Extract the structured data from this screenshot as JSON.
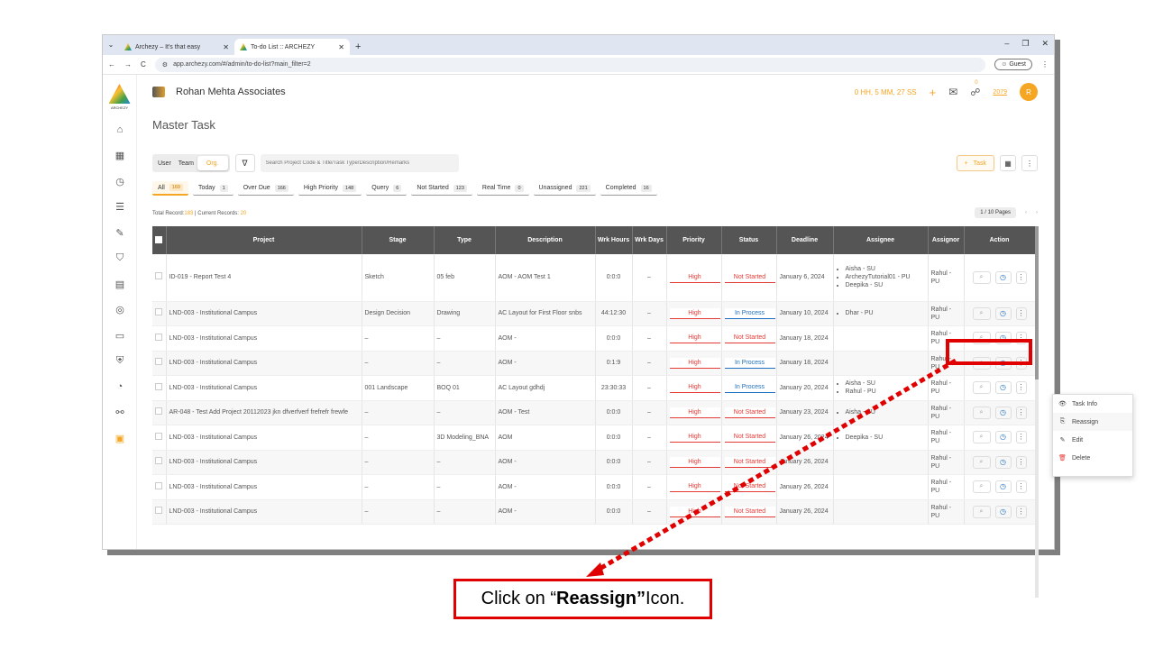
{
  "browser": {
    "tabs": [
      {
        "label": "Archezy – It's that easy"
      },
      {
        "label": "To-do List :: ARCHEZY"
      }
    ],
    "url": "app.archezy.com/#/admin/to-do-list?main_filter=2",
    "guest_label": "Guest"
  },
  "sidebar": {
    "brand_text": "ARCHEZY"
  },
  "topbar": {
    "company": "Rohan Mehta Associates",
    "timer": "0 HH, 5 MM, 27 SS",
    "notif_count": "0",
    "points": "2079",
    "avatar": "R"
  },
  "page": {
    "title": "Master Task"
  },
  "toolbar": {
    "scope": [
      "User",
      "Team",
      "Org."
    ],
    "search_placeholder": "Search Project Code & Title/Task Type/Description/Remarks",
    "task_button": "Task"
  },
  "chips": [
    {
      "label": "All",
      "count": "169"
    },
    {
      "label": "Today",
      "count": "1"
    },
    {
      "label": "Over Due",
      "count": "166"
    },
    {
      "label": "High Priority",
      "count": "148"
    },
    {
      "label": "Query",
      "count": "6"
    },
    {
      "label": "Not Started",
      "count": "123"
    },
    {
      "label": "Real Time",
      "count": "0"
    },
    {
      "label": "Unassigned",
      "count": "221"
    },
    {
      "label": "Completed",
      "count": "16"
    }
  ],
  "records": {
    "total_label": "Total Record:",
    "total": "183",
    "current_label": " | Current Records: ",
    "current": "20"
  },
  "pager": {
    "text": "1 / 10 Pages"
  },
  "table": {
    "headers": [
      "Project",
      "Stage",
      "Type",
      "Description",
      "Wrk Hours",
      "Wrk Days",
      "Priority",
      "Status",
      "Deadline",
      "Assignee",
      "Assignor",
      "Action"
    ],
    "rows": [
      {
        "project": "ID-019 - Report Test 4",
        "stage": "Sketch",
        "type": "05 feb",
        "desc": "AOM - AOM Test 1",
        "hours": "0:0:0",
        "days": "–",
        "priority": "High",
        "status": "Not Started",
        "deadline": "January 6, 2024",
        "assignee": [
          "Aisha - SU",
          "ArchezyTutorial01 - PU",
          "Deepika - SU"
        ],
        "assignor": "Rahul - PU"
      },
      {
        "project": "LND-003 - Institutional Campus",
        "stage": "Design Decision",
        "type": "Drawing",
        "desc": "AC Layout for First Floor snbs",
        "hours": "44:12:30",
        "days": "–",
        "priority": "High",
        "status": "In Process",
        "deadline": "January 10, 2024",
        "assignee": [
          "Dhar - PU"
        ],
        "assignor": "Rahul - PU"
      },
      {
        "project": "LND-003 - Institutional Campus",
        "stage": "–",
        "type": "–",
        "desc": "AOM -",
        "hours": "0:0:0",
        "days": "–",
        "priority": "High",
        "status": "Not Started",
        "deadline": "January 18, 2024",
        "assignee": [],
        "assignor": "Rahul - PU"
      },
      {
        "project": "LND-003 - Institutional Campus",
        "stage": "–",
        "type": "–",
        "desc": "AOM -",
        "hours": "0:1:9",
        "days": "–",
        "priority": "High",
        "status": "In Process",
        "deadline": "January 18, 2024",
        "assignee": [],
        "assignor": "Rahul - PU"
      },
      {
        "project": "LND-003 - Institutional Campus",
        "stage": "001 Landscape",
        "type": "BOQ 01",
        "desc": "AC Layout gdhdj",
        "hours": "23:30:33",
        "days": "–",
        "priority": "High",
        "status": "In Process",
        "deadline": "January 20, 2024",
        "assignee": [
          "Aisha - SU",
          "Rahul - PU"
        ],
        "assignor": "Rahul - PU"
      },
      {
        "project": "AR-048 - Test Add Project 20112023 jkn dfverfverf frefrefr frewfe",
        "stage": "–",
        "type": "–",
        "desc": "AOM - Test",
        "hours": "0:0:0",
        "days": "–",
        "priority": "High",
        "status": "Not Started",
        "deadline": "January 23, 2024",
        "assignee": [
          "Aisha - SU"
        ],
        "assignor": "Rahul - PU"
      },
      {
        "project": "LND-003 - Institutional Campus",
        "stage": "–",
        "type": "3D Modeling_BNA",
        "desc": "AOM",
        "hours": "0:0:0",
        "days": "–",
        "priority": "High",
        "status": "Not Started",
        "deadline": "January 26, 2024",
        "assignee": [
          "Deepika - SU"
        ],
        "assignor": "Rahul - PU"
      },
      {
        "project": "LND-003 - Institutional Campus",
        "stage": "–",
        "type": "–",
        "desc": "AOM -",
        "hours": "0:0:0",
        "days": "–",
        "priority": "High",
        "status": "Not Started",
        "deadline": "January 26, 2024",
        "assignee": [],
        "assignor": "Rahul - PU"
      },
      {
        "project": "LND-003 - Institutional Campus",
        "stage": "–",
        "type": "–",
        "desc": "AOM -",
        "hours": "0:0:0",
        "days": "–",
        "priority": "High",
        "status": "Not Started",
        "deadline": "January 26, 2024",
        "assignee": [],
        "assignor": "Rahul - PU"
      },
      {
        "project": "LND-003 - Institutional Campus",
        "stage": "–",
        "type": "–",
        "desc": "AOM -",
        "hours": "0:0:0",
        "days": "–",
        "priority": "High",
        "status": "Not Started",
        "deadline": "January 26, 2024",
        "assignee": [],
        "assignor": "Rahul - PU"
      }
    ]
  },
  "context_menu": {
    "items": [
      "Task Info",
      "Reassign",
      "Edit",
      "Delete"
    ]
  },
  "annotation": {
    "prefix": "Click on “",
    "bold": "Reassign”",
    "suffix": " Icon.",
    "color": "#e00000"
  }
}
